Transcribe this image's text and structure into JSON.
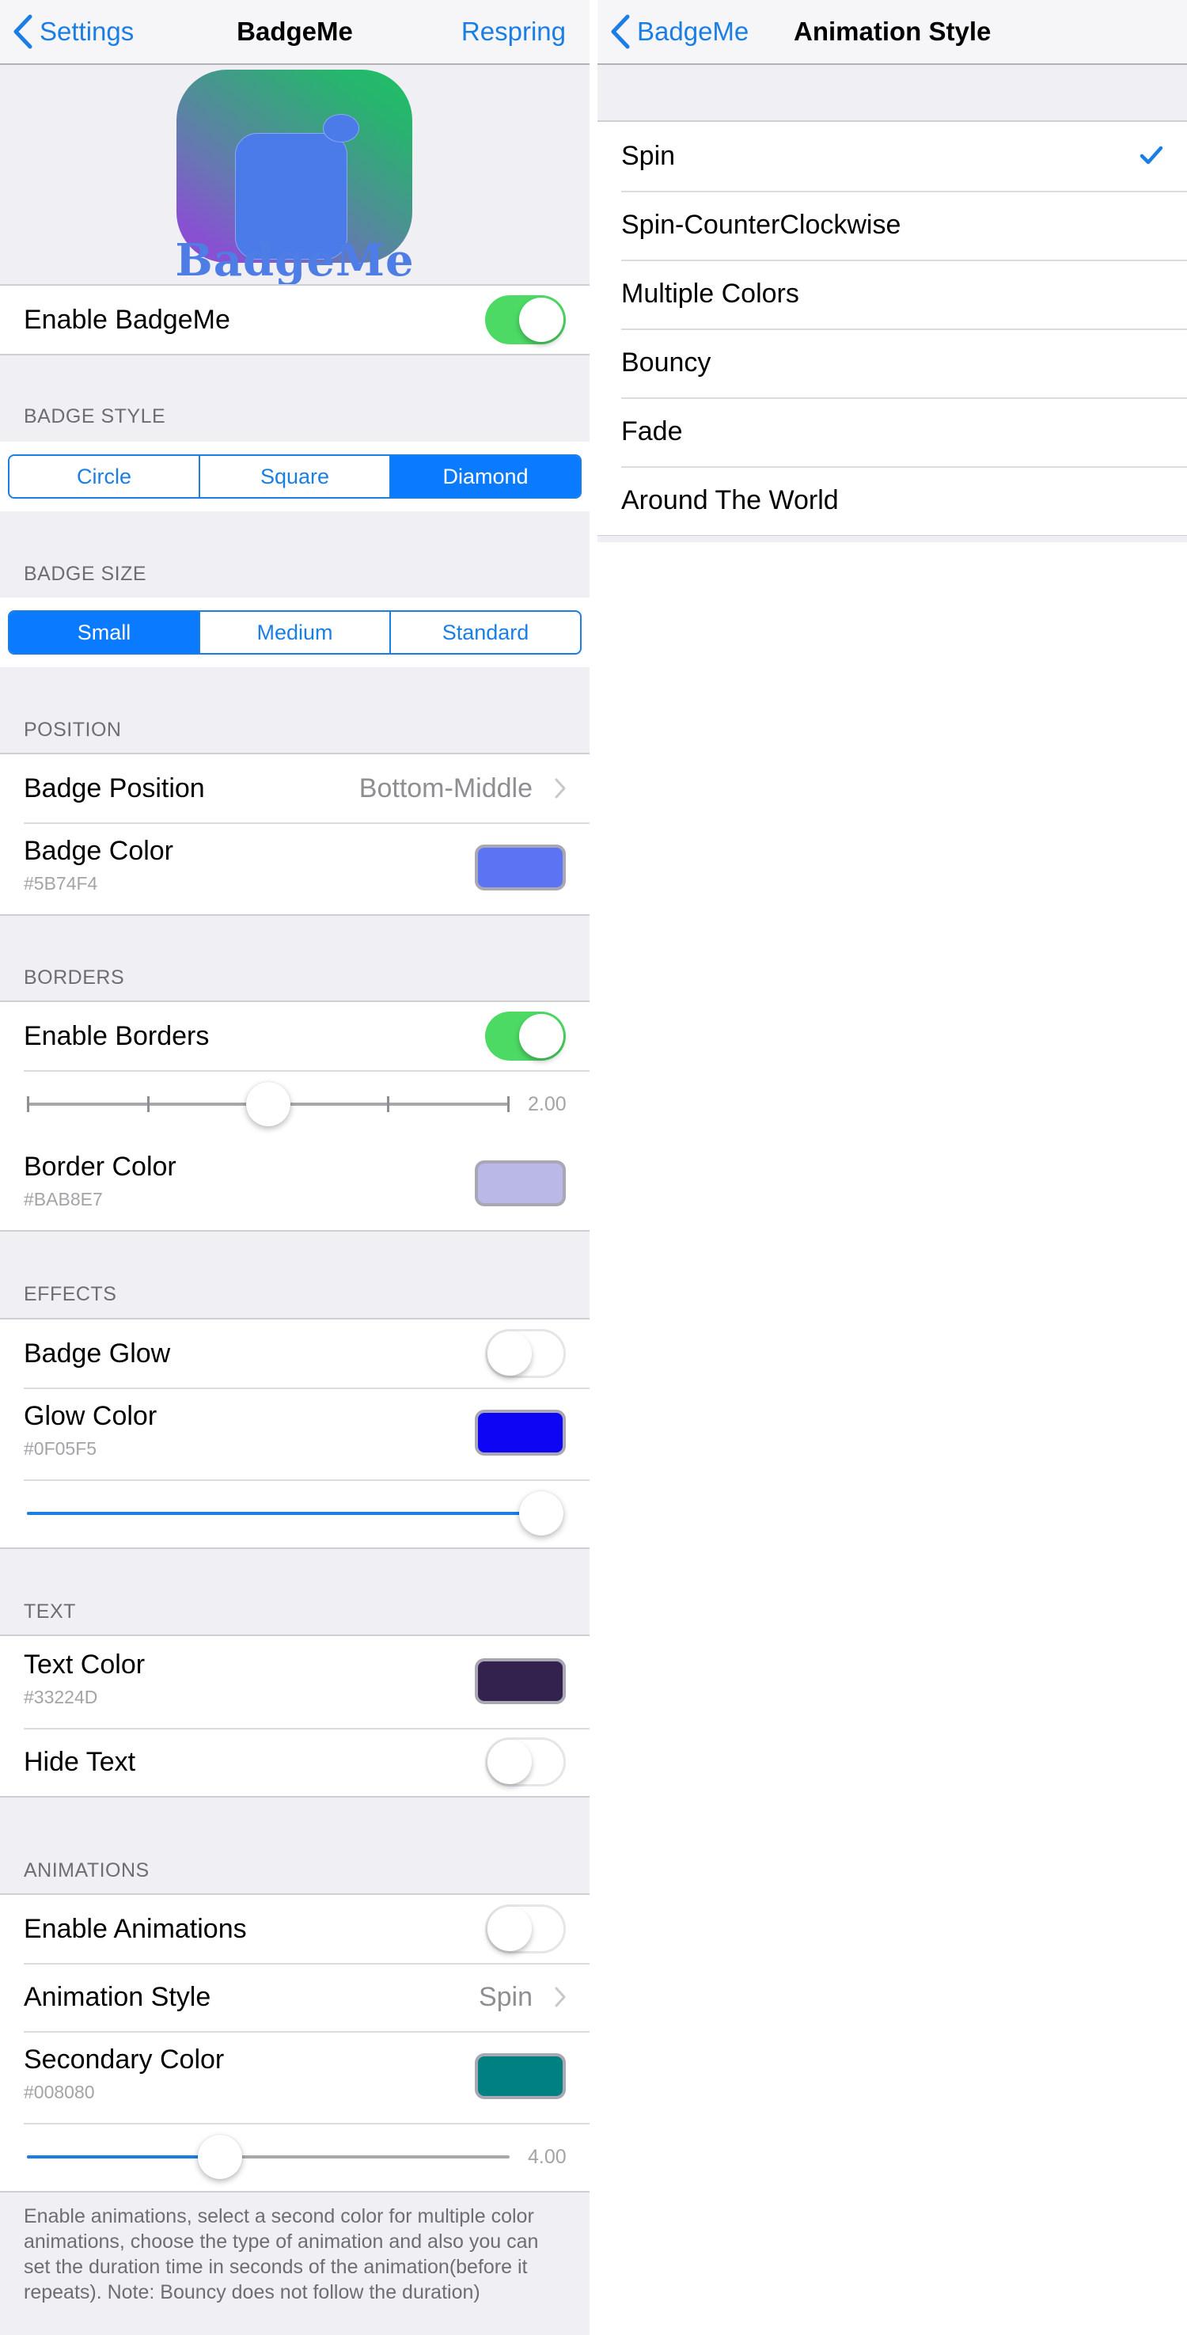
{
  "left_panel": {
    "navbar": {
      "back_label": "Settings",
      "title": "BadgeMe",
      "action_label": "Respring"
    },
    "logo": {
      "text": "BadgeMe"
    },
    "enable_row": {
      "label": "Enable BadgeMe",
      "on": true
    },
    "badge_style": {
      "header": "BADGE STYLE",
      "options": [
        "Circle",
        "Square",
        "Diamond"
      ],
      "selected": "Diamond"
    },
    "badge_size": {
      "header": "BADGE SIZE",
      "options": [
        "Small",
        "Medium",
        "Standard"
      ],
      "selected": "Small"
    },
    "position": {
      "header": "POSITION",
      "badge_position": {
        "label": "Badge Position",
        "value": "Bottom-Middle"
      },
      "badge_color": {
        "label": "Badge Color",
        "hex": "#5B74F4",
        "color": "#5B74F4"
      }
    },
    "borders": {
      "header": "BORDERS",
      "enable": {
        "label": "Enable Borders",
        "on": true
      },
      "width_slider": {
        "value_text": "2.00",
        "min": 0,
        "max": 4,
        "value": 2,
        "ticks": 5
      },
      "border_color": {
        "label": "Border Color",
        "hex": "#BAB8E7",
        "color": "#BAB8E7"
      }
    },
    "effects": {
      "header": "EFFECTS",
      "glow": {
        "label": "Badge Glow",
        "on": false
      },
      "glow_color": {
        "label": "Glow Color",
        "hex": "#0F05F5",
        "color": "#0F05F5"
      },
      "glow_slider": {
        "fraction": 1.0
      }
    },
    "text": {
      "header": "TEXT",
      "text_color": {
        "label": "Text Color",
        "hex": "#33224D",
        "color": "#33224D"
      },
      "hide_text": {
        "label": "Hide Text",
        "on": false
      }
    },
    "animations": {
      "header": "ANIMATIONS",
      "enable": {
        "label": "Enable Animations",
        "on": false
      },
      "style": {
        "label": "Animation Style",
        "value": "Spin"
      },
      "secondary_color": {
        "label": "Secondary Color",
        "hex": "#008080",
        "color": "#008080"
      },
      "duration_slider": {
        "value_text": "4.00",
        "fraction": 0.4
      },
      "footer": "Enable animations, select a second color for multiple color animations, choose the type of animation and also you can set the duration time in seconds of the animation(before it repeats). Note: Bouncy does not follow the duration)"
    }
  },
  "right_panel": {
    "navbar": {
      "back_label": "BadgeMe",
      "title": "Animation Style"
    },
    "options": [
      "Spin",
      "Spin-CounterClockwise",
      "Multiple Colors",
      "Bouncy",
      "Fade",
      "Around The World"
    ],
    "selected": "Spin"
  },
  "colors": {
    "accent": "#1A7EE5",
    "toggle_on": "#4CD964"
  }
}
